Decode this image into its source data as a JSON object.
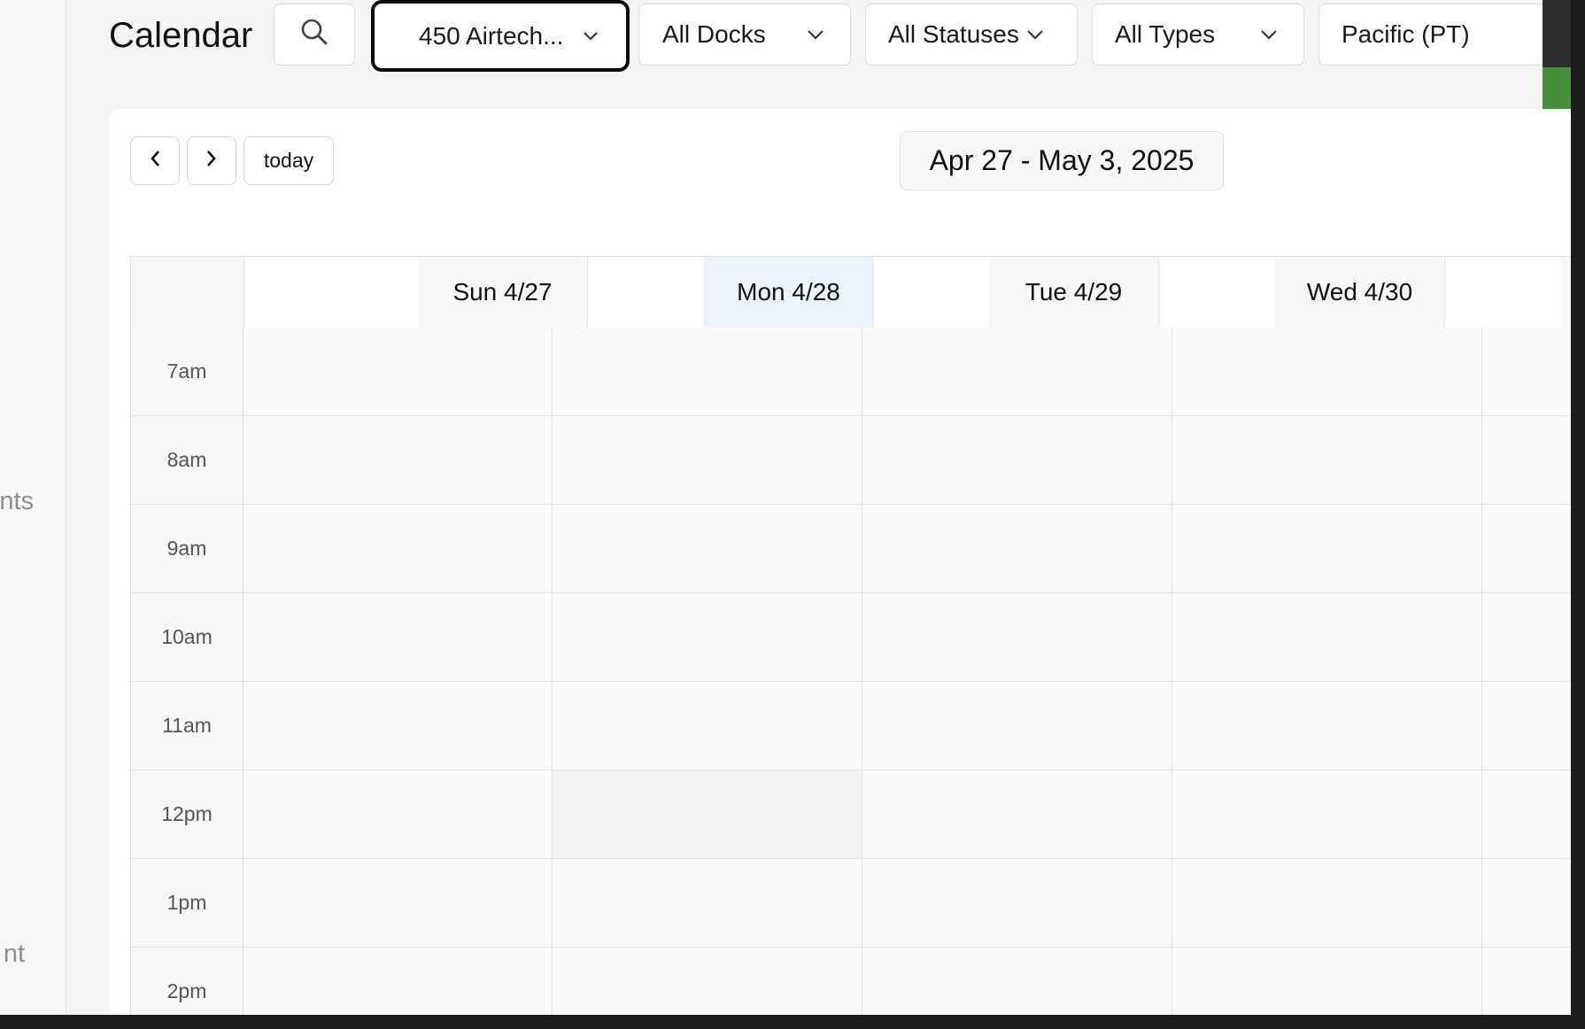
{
  "app": {
    "title": "Calendar"
  },
  "sidebar": {
    "fragments": [
      "nts",
      "nt"
    ]
  },
  "filters": {
    "location": "450 Airtech...",
    "docks": "All Docks",
    "statuses": "All Statuses",
    "types": "All Types",
    "timezone": "Pacific (PT)"
  },
  "toolbar": {
    "today_label": "today",
    "range_label": "Apr 27 - May 3, 2025"
  },
  "calendar": {
    "days": [
      {
        "label": "Sun 4/27",
        "today": false
      },
      {
        "label": "Mon 4/28",
        "today": true
      },
      {
        "label": "Tue 4/29",
        "today": false
      },
      {
        "label": "Wed 4/30",
        "today": false
      }
    ],
    "hours": [
      "7am",
      "8am",
      "9am",
      "10am",
      "11am",
      "12pm",
      "1pm",
      "2pm"
    ]
  },
  "colors": {
    "accent_green": "#4a8f3d",
    "today_header": "#ebf3fd"
  },
  "icons": {
    "search": "search-icon",
    "chevron": "chevron-down-icon",
    "prev": "chevron-left-icon",
    "next": "chevron-right-icon"
  }
}
